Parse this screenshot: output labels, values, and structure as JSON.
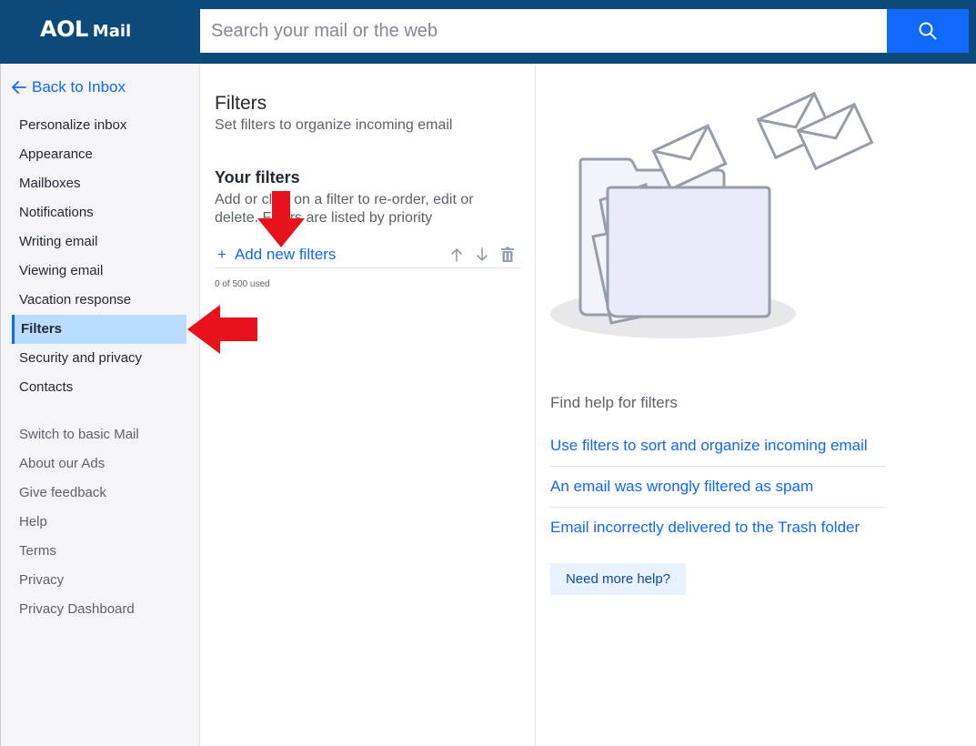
{
  "header": {
    "logo_brand": "AOL",
    "logo_product": "Mail",
    "search_placeholder": "Search your mail or the web",
    "search_icon": "search-icon",
    "colors": {
      "bar": "#0c4a7c",
      "search_button": "#0f69ff"
    }
  },
  "sidebar": {
    "back_label": "Back to Inbox",
    "items": [
      {
        "label": "Personalize inbox"
      },
      {
        "label": "Appearance"
      },
      {
        "label": "Mailboxes"
      },
      {
        "label": "Notifications"
      },
      {
        "label": "Writing email"
      },
      {
        "label": "Viewing email"
      },
      {
        "label": "Vacation response"
      },
      {
        "label": "Filters",
        "active": true
      },
      {
        "label": "Security and privacy"
      },
      {
        "label": "Contacts"
      }
    ],
    "secondary_items": [
      {
        "label": "Switch to basic Mail"
      },
      {
        "label": "About our Ads"
      },
      {
        "label": "Give feedback"
      },
      {
        "label": "Help"
      },
      {
        "label": "Terms"
      },
      {
        "label": "Privacy"
      },
      {
        "label": "Privacy Dashboard"
      }
    ]
  },
  "main": {
    "title": "Filters",
    "subtitle": "Set filters to organize incoming email",
    "section_title": "Your filters",
    "section_desc": "Add or click on a filter to re-order, edit or delete. Filters are listed by priority",
    "add_label": "Add new filters",
    "usage": "0 of 500 used",
    "controls": [
      "arrow-up-icon",
      "arrow-down-icon",
      "trash-icon"
    ]
  },
  "help": {
    "title": "Find help for filters",
    "links": [
      "Use filters to sort and organize incoming email",
      "An email was wrongly filtered as spam",
      "Email incorrectly delivered to the Trash folder"
    ],
    "more_button": "Need more help?"
  },
  "annotations": {
    "arrow_color": "#e8121c"
  }
}
